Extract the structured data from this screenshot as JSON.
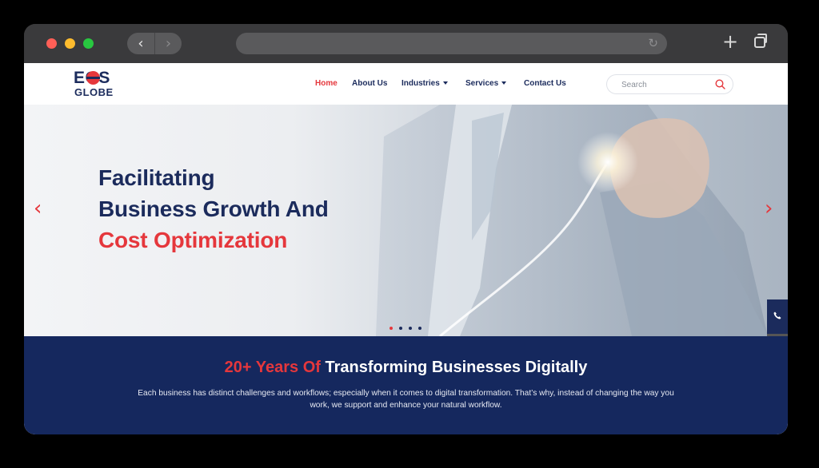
{
  "nav": {
    "items": [
      {
        "label": "Home",
        "active": true,
        "dropdown": false
      },
      {
        "label": "About Us",
        "active": false,
        "dropdown": false
      },
      {
        "label": "Industries",
        "active": false,
        "dropdown": true
      },
      {
        "label": "Services",
        "active": false,
        "dropdown": true
      },
      {
        "label": "Contact Us",
        "active": false,
        "dropdown": false
      }
    ]
  },
  "logo": {
    "line1": "EOS",
    "line2": "GLOBE"
  },
  "search": {
    "placeholder": "Search",
    "icon": "search-icon"
  },
  "hero": {
    "title_line1": "Facilitating",
    "title_line2": "Business Growth And",
    "title_line3": "Cost Optimization",
    "slides": 4,
    "active_slide": 1
  },
  "band": {
    "title_highlight": "20+ Years Of",
    "title_rest": "Transforming Businesses Digitally",
    "text": "Each business has distinct challenges and workflows; especially when it comes to digital transformation. That’s why, instead of changing the way you work, we support and enhance your natural workflow."
  },
  "side_buttons": [
    "document-icon",
    "phone-icon",
    "login-icon"
  ],
  "colors": {
    "primary": "#1b2b5c",
    "accent": "#e5373c",
    "band": "#15285e"
  }
}
